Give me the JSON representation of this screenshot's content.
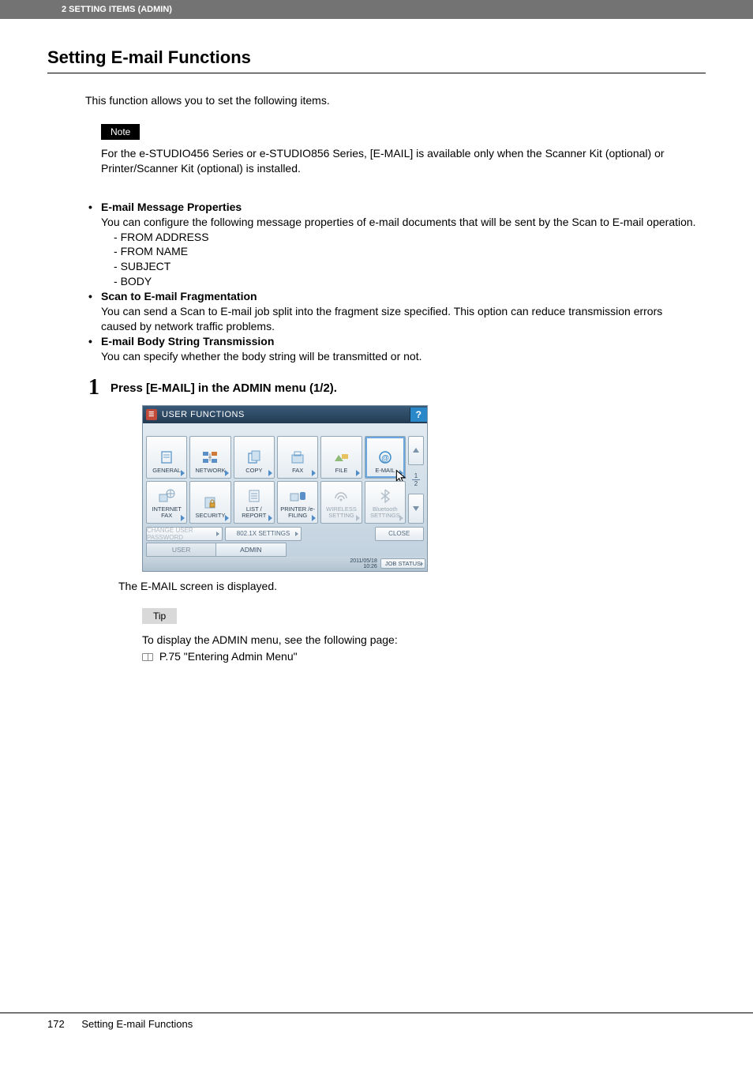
{
  "header_bar": "2 SETTING ITEMS (ADMIN)",
  "title": "Setting E-mail Functions",
  "intro": "This function allows you to set the following items.",
  "note": {
    "label": "Note",
    "body": "For the e-STUDIO456 Series or e-STUDIO856 Series, [E-MAIL] is available only when the Scanner Kit (optional) or Printer/Scanner Kit (optional) is installed."
  },
  "bullets": [
    {
      "head": "E-mail Message Properties",
      "body": "You can configure the following message properties of e-mail documents that will be sent by the Scan to E-mail operation.",
      "dashes": [
        "FROM ADDRESS",
        "FROM NAME",
        "SUBJECT",
        "BODY"
      ]
    },
    {
      "head": "Scan to E-mail Fragmentation",
      "body": "You can send a Scan to E-mail job split into the fragment size specified. This option can reduce transmission errors caused by network traffic problems."
    },
    {
      "head": "E-mail Body String Transmission",
      "body": "You can specify whether the body string will be transmitted or not."
    }
  ],
  "step": {
    "num": "1",
    "text": "Press [E-MAIL] in the ADMIN menu (1/2)."
  },
  "after_step": "The E-MAIL screen is displayed.",
  "tip": {
    "label": "Tip",
    "line1": "To display the ADMIN menu, see the following page:",
    "line2": "P.75 \"Entering Admin Menu\""
  },
  "panel": {
    "title": "USER FUNCTIONS",
    "help": "?",
    "tiles_row1": [
      {
        "label": "GENERAL",
        "icon": "general"
      },
      {
        "label": "NETWORK",
        "icon": "network"
      },
      {
        "label": "COPY",
        "icon": "copy"
      },
      {
        "label": "FAX",
        "icon": "fax"
      },
      {
        "label": "FILE",
        "icon": "file"
      },
      {
        "label": "E-MAIL",
        "icon": "email",
        "highlight": true
      }
    ],
    "tiles_row2": [
      {
        "label": "INTERNET FAX",
        "icon": "ifax"
      },
      {
        "label": "SECURITY",
        "icon": "security"
      },
      {
        "label": "LIST / REPORT",
        "icon": "list"
      },
      {
        "label": "PRINTER /e-FILING",
        "icon": "printer"
      },
      {
        "label": "WIRELESS SETTING",
        "icon": "wireless",
        "disabled": true
      },
      {
        "label": "Bluetooth SETTINGS",
        "icon": "bluetooth",
        "disabled": true
      }
    ],
    "page_current": "1",
    "page_total": "2",
    "bar_buttons": {
      "change_pw": "CHANGE USER PASSWORD",
      "dot1x": "802.1X SETTINGS",
      "close": "CLOSE"
    },
    "tabs": {
      "user": "USER",
      "admin": "ADMIN"
    },
    "timestamp": "2011/05/18\n10:26",
    "job_status": "JOB STATUS"
  },
  "footer": {
    "page_num": "172",
    "running_title": "Setting E-mail Functions"
  }
}
